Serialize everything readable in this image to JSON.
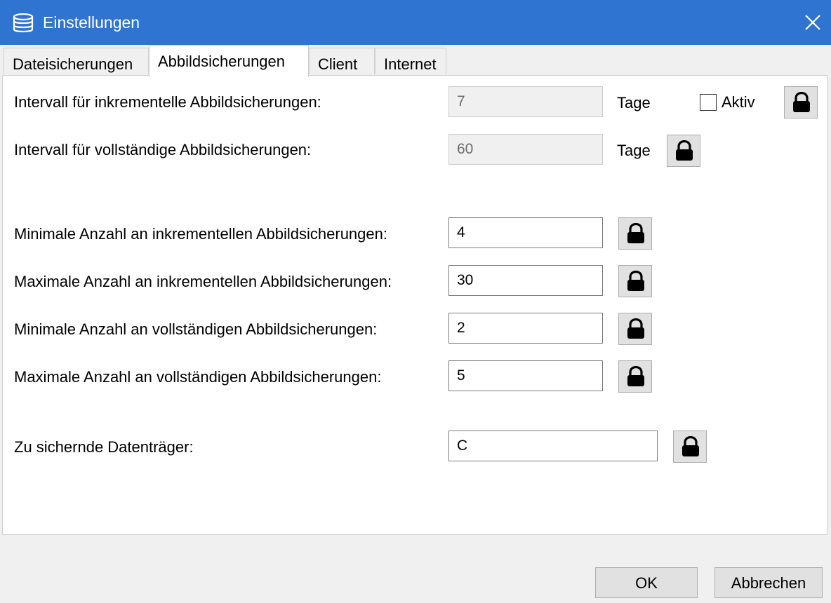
{
  "window": {
    "title": "Einstellungen",
    "app_icon": "database-icon",
    "close_icon": "close-icon"
  },
  "tabs": [
    {
      "label": "Dateisicherungen",
      "active": false
    },
    {
      "label": "Abbildsicherungen",
      "active": true
    },
    {
      "label": "Client",
      "active": false
    },
    {
      "label": "Internet",
      "active": false
    }
  ],
  "settings": {
    "incr_interval": {
      "label": "Intervall für inkrementelle Abbildsicherungen:",
      "value": "7",
      "unit": "Tage",
      "enabled": false,
      "active_label": "Aktiv",
      "active_checked": false
    },
    "full_interval": {
      "label": "Intervall für vollständige Abbildsicherungen:",
      "value": "60",
      "unit": "Tage",
      "enabled": false
    },
    "min_incr": {
      "label": "Minimale Anzahl an inkrementellen Abbildsicherungen:",
      "value": "4"
    },
    "max_incr": {
      "label": "Maximale Anzahl an inkrementellen Abbildsicherungen:",
      "value": "30"
    },
    "min_full": {
      "label": "Minimale Anzahl an vollständigen Abbildsicherungen:",
      "value": "2"
    },
    "max_full": {
      "label": "Maximale Anzahl an vollständigen Abbildsicherungen:",
      "value": "5"
    },
    "volumes": {
      "label": "Zu sichernde Datenträger:",
      "value": "C"
    }
  },
  "lock_icon": "lock-icon",
  "buttons": {
    "ok": "OK",
    "cancel": "Abbrechen"
  },
  "colors": {
    "titlebar": "#2f74d0",
    "panel": "#ffffff",
    "background": "#f0f0f0"
  }
}
